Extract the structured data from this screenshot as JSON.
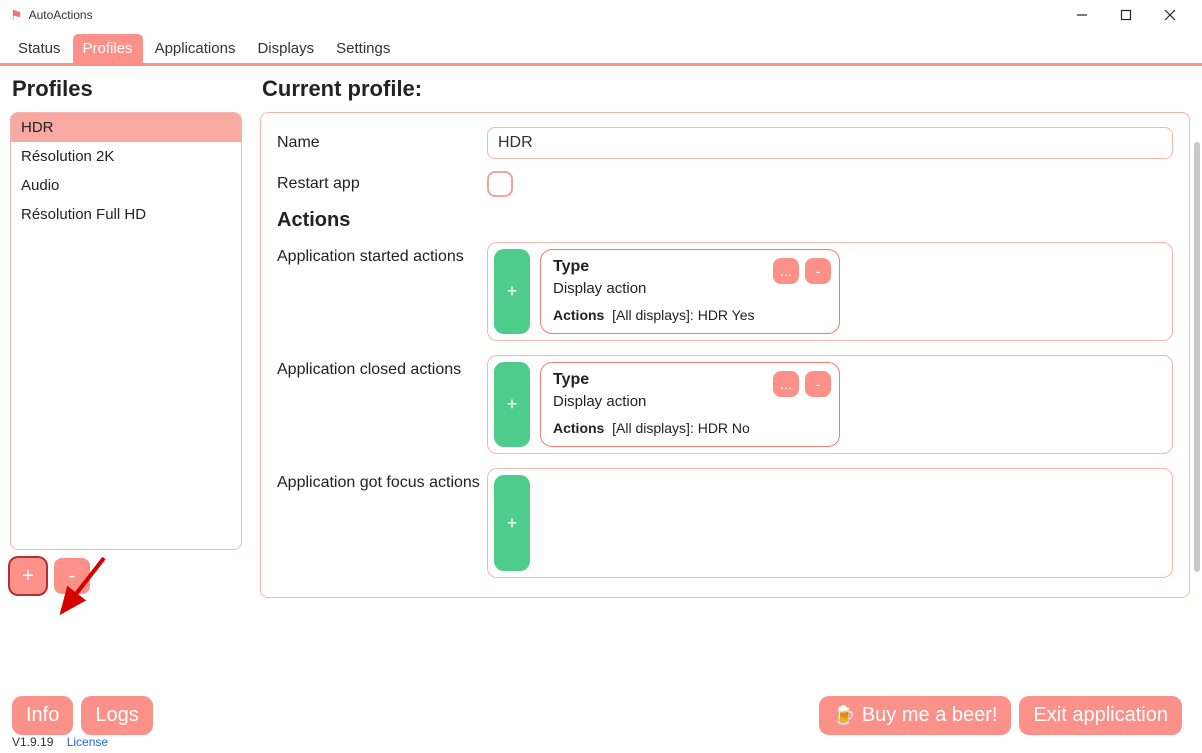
{
  "window": {
    "title": "AutoActions"
  },
  "tabs": [
    {
      "label": "Status",
      "active": false
    },
    {
      "label": "Profiles",
      "active": true
    },
    {
      "label": "Applications",
      "active": false
    },
    {
      "label": "Displays",
      "active": false
    },
    {
      "label": "Settings",
      "active": false
    }
  ],
  "left": {
    "heading": "Profiles",
    "items": [
      {
        "label": "HDR",
        "selected": true
      },
      {
        "label": "Résolution 2K",
        "selected": false
      },
      {
        "label": "Audio",
        "selected": false
      },
      {
        "label": "Résolution Full HD",
        "selected": false
      }
    ],
    "add": "+",
    "remove": "-"
  },
  "right": {
    "heading": "Current profile:",
    "name_label": "Name",
    "name_value": "HDR",
    "restart_label": "Restart app",
    "restart_checked": false,
    "actions_heading": "Actions",
    "groups": [
      {
        "label": "Application started actions",
        "items": [
          {
            "type_label": "Type",
            "type_value": "Display action",
            "actions_label": "Actions",
            "actions_value": "[All displays]: HDR Yes"
          }
        ]
      },
      {
        "label": "Application closed actions",
        "items": [
          {
            "type_label": "Type",
            "type_value": "Display action",
            "actions_label": "Actions",
            "actions_value": "[All displays]: HDR No"
          }
        ]
      },
      {
        "label": "Application got focus actions",
        "items": []
      }
    ],
    "add": "+",
    "item_more": "...",
    "item_remove": "-"
  },
  "footer": {
    "info": "Info",
    "logs": "Logs",
    "beer": "Buy me a beer!",
    "exit": "Exit application",
    "version": "V1.9.19",
    "license": "License"
  }
}
